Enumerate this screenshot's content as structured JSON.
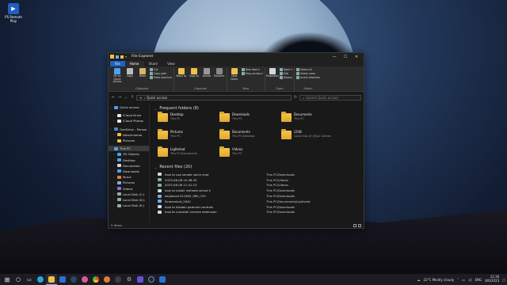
{
  "desktop": {
    "icon_label": "PS Remote Play"
  },
  "window": {
    "title": "File Explorer",
    "tabs": [
      "File",
      "Home",
      "Share",
      "View"
    ],
    "ribbon": {
      "clipboard": {
        "label": "Clipboard",
        "pin": "Pin to Quick access",
        "copy": "Copy",
        "paste": "Paste",
        "cut": "Cut",
        "copy_path": "Copy path",
        "paste_shortcut": "Paste shortcut"
      },
      "organize": {
        "label": "Organize",
        "move_to": "Move to",
        "copy_to": "Copy to",
        "delete": "Delete",
        "rename": "Rename"
      },
      "new": {
        "label": "New",
        "new_folder": "New folder",
        "new_item": "New item ▾",
        "easy_access": "Easy access ▾"
      },
      "open": {
        "label": "Open",
        "properties": "Properties",
        "open": "Open ▾",
        "edit": "Edit",
        "history": "History"
      },
      "select": {
        "label": "Select",
        "select_all": "Select all",
        "select_none": "Select none",
        "invert_selection": "Invert selection"
      }
    },
    "address": {
      "path": "Quick access",
      "search_placeholder": "Search Quick access"
    },
    "nav": [
      {
        "label": "Quick access",
        "color": "#4ea1f3"
      },
      {
        "label": "iCloud Drive",
        "color": "#e8e8e8"
      },
      {
        "label": "iCloud Photos",
        "color": "#e8e8e8"
      },
      {
        "label": "OneDrive - Person",
        "color": "#3d8bd9"
      },
      {
        "label": "Attachments",
        "color": "#f0c04a"
      },
      {
        "label": "Pictures",
        "color": "#f0c04a"
      },
      {
        "label": "This PC",
        "color": "#5aa0e6"
      },
      {
        "label": "3D Objects",
        "color": "#4ea1f3"
      },
      {
        "label": "Desktop",
        "color": "#4ea1f3"
      },
      {
        "label": "Documents",
        "color": "#cfd8e3"
      },
      {
        "label": "Downloads",
        "color": "#4ea1f3"
      },
      {
        "label": "Music",
        "color": "#e87a3c"
      },
      {
        "label": "Pictures",
        "color": "#6fb0e8"
      },
      {
        "label": "Videos",
        "color": "#8a6fe0"
      },
      {
        "label": "Local Disk (C:)",
        "color": "#9aa"
      },
      {
        "label": "Local Disk (D:)",
        "color": "#9aa"
      },
      {
        "label": "Local Disk (E:)",
        "color": "#9aa"
      }
    ],
    "frequent": {
      "title": "Frequent folders (8)",
      "items": [
        {
          "name": "Desktop",
          "sub": "This PC"
        },
        {
          "name": "Downloads",
          "sub": "This PC"
        },
        {
          "name": "Documents",
          "sub": "This PC"
        },
        {
          "name": "Pictures",
          "sub": "This PC"
        },
        {
          "name": "Documents",
          "sub": "This PC\\Desktop"
        },
        {
          "name": "(2)\\B",
          "sub": "Local Disk (E:)\\Epic Games"
        },
        {
          "name": "Lightshot",
          "sub": "This PC\\Documents"
        },
        {
          "name": "Videos",
          "sub": "This PC"
        }
      ]
    },
    "recent": {
      "title": "Recent files (20)",
      "items": [
        {
          "name": "how to use simple voice chat",
          "loc": "This PC\\Downloads",
          "color": "#cfd8e3"
        },
        {
          "name": "2023-08-08 10-36-30",
          "loc": "This PC\\Videos",
          "color": "#8aa"
        },
        {
          "name": "2023-08-08 11-41-15",
          "loc": "This PC\\Videos",
          "color": "#8aa"
        },
        {
          "name": "how to install reshade simsd 4",
          "loc": "This PC\\Downloads",
          "color": "#cfd8e3"
        },
        {
          "name": "keyboard-311803_960_720",
          "loc": "This PC\\Downloads",
          "color": "#6fb0e8"
        },
        {
          "name": "Screenshot_2642",
          "loc": "This PC\\Documents\\Lightshot",
          "color": "#6fb0e8"
        },
        {
          "name": "how to disable parental controls",
          "loc": "This PC\\Downloads",
          "color": "#cfd8e3"
        },
        {
          "name": "how to uninstall chrome extension",
          "loc": "This PC\\Downloads",
          "color": "#cfd8e3"
        }
      ]
    },
    "status": {
      "items": "9 items"
    }
  },
  "taskbar": {
    "weather": "22°C  Mostly cloudy",
    "lang": "ENG",
    "time": "12:36",
    "date": "8/6/2023"
  }
}
